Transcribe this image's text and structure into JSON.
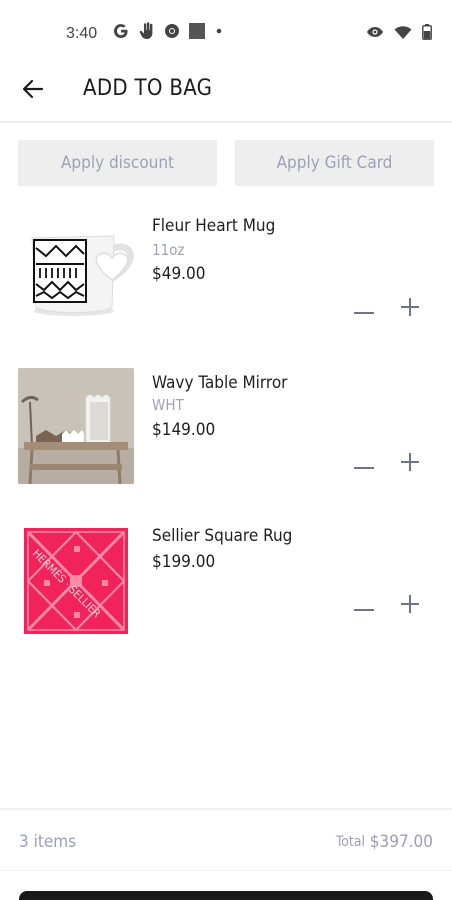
{
  "status_bar": {
    "time": "3:40",
    "left_icons": [
      "google-icon",
      "hand-icon",
      "chrome-icon",
      "square-app-icon",
      "dot-icon"
    ],
    "right_icons": [
      "eye-icon",
      "wifi-icon",
      "battery-icon"
    ]
  },
  "app_bar": {
    "title": "ADD TO BAG"
  },
  "actions": {
    "discount_label": "Apply discount",
    "gift_card_label": "Apply Gift Card"
  },
  "items": [
    {
      "name": "Fleur Heart Mug",
      "variant": "11oz",
      "price": "$49.00",
      "image": "mug-image"
    },
    {
      "name": "Wavy Table Mirror",
      "variant": "WHT",
      "price": "$149.00",
      "image": "mirror-image"
    },
    {
      "name": "Sellier Square Rug",
      "variant": "",
      "price": "$199.00",
      "image": "rug-image",
      "rug_text": "HERMÈS · SELLIER"
    }
  ],
  "footer": {
    "items_count": "3 items",
    "total_label": "Total",
    "total_value": "$397.00"
  },
  "colors": {
    "accent_muted": "#9c9fb8",
    "button_bg": "#eeeeee",
    "rug_pink": "#f0245a",
    "checkout_bg": "#1a1a1a"
  }
}
